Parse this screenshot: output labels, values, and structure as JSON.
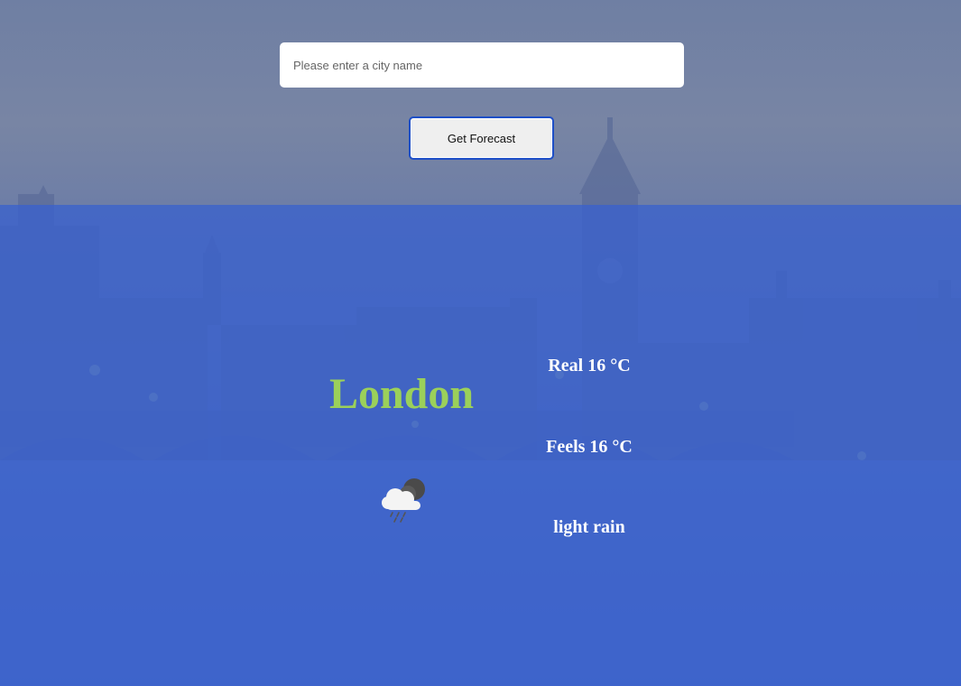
{
  "search": {
    "placeholder": "Please enter a city name",
    "value": "",
    "button_label": "Get Forecast"
  },
  "weather": {
    "city": "London",
    "icon": "cloud-rain-night-icon",
    "real_label": "Real 16 °C",
    "feels_label": "Feels 16 °C",
    "description": "light rain"
  },
  "colors": {
    "city_name": "#9bd05a",
    "panel_overlay": "#3a62cd",
    "button_border": "#1e4fc7"
  }
}
